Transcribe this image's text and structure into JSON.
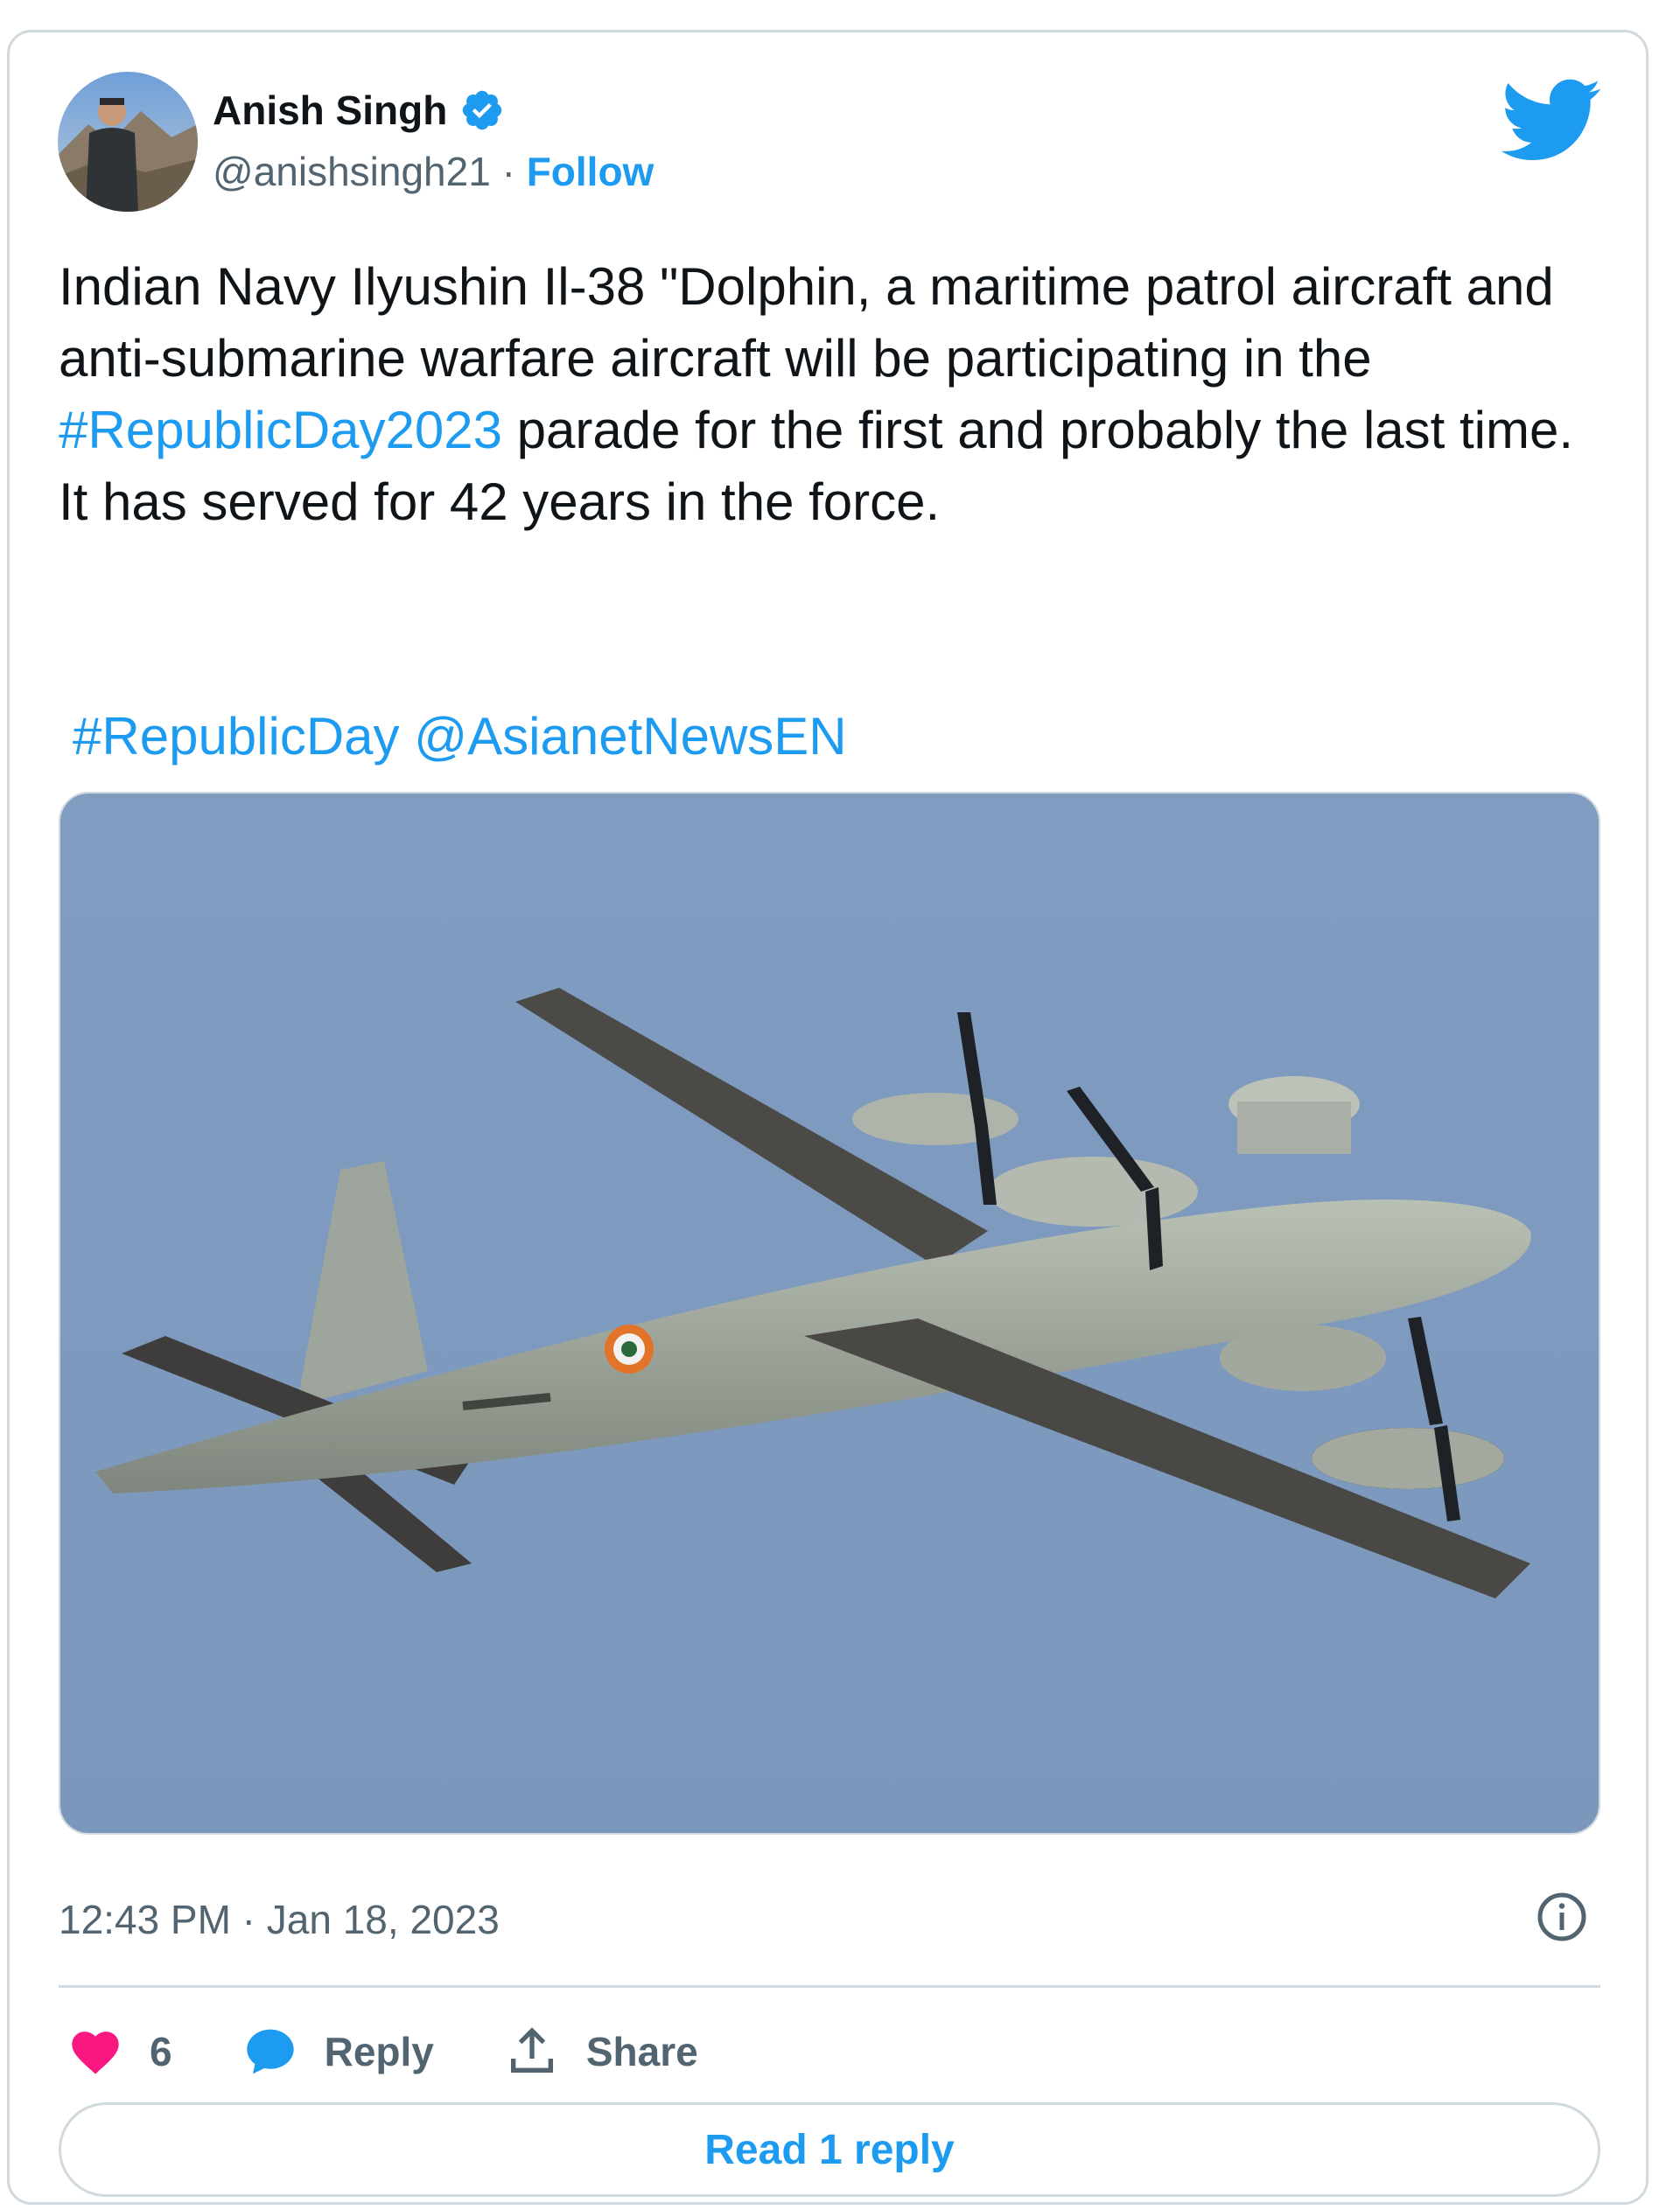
{
  "tweet": {
    "author_name": "Anish Singh",
    "handle": "@anishsingh21",
    "separator": "·",
    "follow_label": "Follow",
    "text_part1": "Indian Navy Ilyushin Il-38 \"Dolphin, a maritime patrol aircraft and anti-submarine warfare aircraft will be participating in the ",
    "text_hashtag": "#RepublicDay2023",
    "text_part2": " parade for the first and probably the last time. It has served for 42 years in the force.",
    "tag1": "#RepublicDay",
    "tag2": "@AsianetNewsEN",
    "timestamp": "12:43 PM · Jan 18, 2023",
    "likes": "6",
    "reply_label": "Reply",
    "share_label": "Share",
    "read_replies_label": "Read 1 reply"
  },
  "colors": {
    "accent": "#1d9bf0",
    "like": "#f91880",
    "text": "#0f1419",
    "muted": "#536471",
    "border": "#cfd9de",
    "sky": "#7f9bbe"
  },
  "icons": {
    "verified": "verified-badge-icon",
    "brand": "twitter-bird-icon",
    "info": "info-icon",
    "like": "heart-icon",
    "reply": "speech-bubble-icon",
    "share": "share-upload-icon"
  }
}
